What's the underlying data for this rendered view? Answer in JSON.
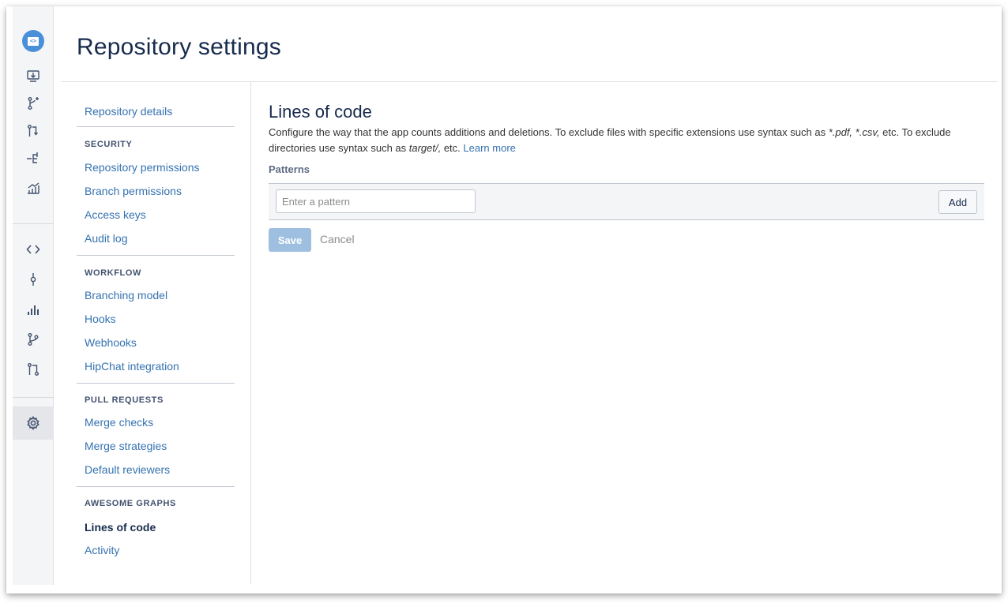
{
  "page": {
    "title": "Repository settings"
  },
  "rail": {
    "icons": [
      "repository-icon",
      "clone-icon",
      "create-branch-icon",
      "create-pull-request-icon",
      "fork-icon",
      "repo-stats-icon",
      "source-icon",
      "commits-icon",
      "graphs-icon",
      "branches-icon",
      "pull-requests-icon",
      "settings-icon"
    ]
  },
  "settings_nav": {
    "repository_details": "Repository details",
    "sections": [
      {
        "heading": "SECURITY",
        "items": [
          "Repository permissions",
          "Branch permissions",
          "Access keys",
          "Audit log"
        ]
      },
      {
        "heading": "WORKFLOW",
        "items": [
          "Branching model",
          "Hooks",
          "Webhooks",
          "HipChat integration"
        ]
      },
      {
        "heading": "PULL REQUESTS",
        "items": [
          "Merge checks",
          "Merge strategies",
          "Default reviewers"
        ]
      },
      {
        "heading": "AWESOME GRAPHS",
        "items": [
          "Lines of code",
          "Activity"
        ]
      }
    ],
    "current": "Lines of code"
  },
  "main": {
    "heading": "Lines of code",
    "description_part1": "Configure the way that the app counts additions and deletions. To exclude files with specific extensions use syntax such as ",
    "ext1": "*.pdf,",
    "ext2": "*.csv,",
    "description_part2": " etc. To exclude directories use syntax such as ",
    "dir_example": "target/,",
    "description_part3": " etc. ",
    "learn_more": "Learn more",
    "patterns_label": "Patterns",
    "pattern_placeholder": "Enter a pattern",
    "add_label": "Add",
    "save_label": "Save",
    "cancel_label": "Cancel"
  },
  "colors": {
    "link": "#3572b0",
    "save_disabled": "#9fbfe1",
    "avatar": "#4a90d9"
  }
}
